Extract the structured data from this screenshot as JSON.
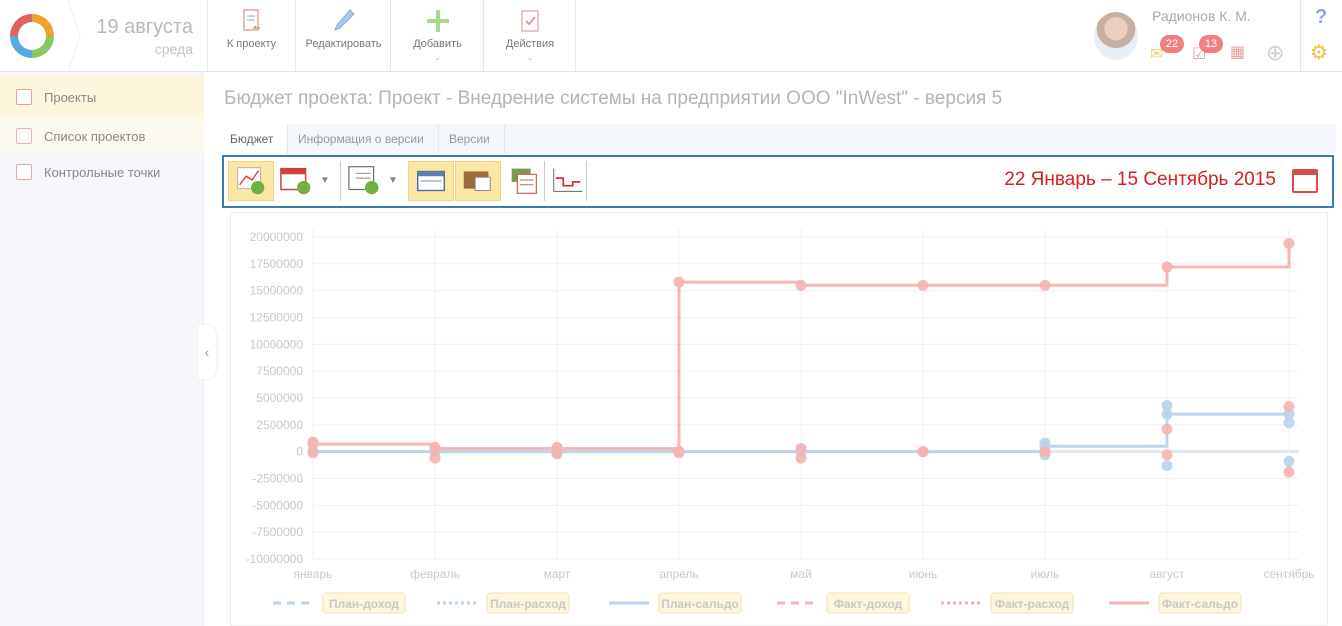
{
  "header": {
    "date_main": "19 августа",
    "date_sub": "среда",
    "buttons": [
      {
        "label": "К проекту",
        "icon": "document-back-icon"
      },
      {
        "label": "Редактировать",
        "icon": "pencil-icon"
      },
      {
        "label": "Добавить",
        "icon": "plus-icon"
      },
      {
        "label": "Действия",
        "icon": "checklist-icon"
      }
    ],
    "user_name": "Радионов К. М.",
    "badges": {
      "mail": "22",
      "tasks": "13"
    }
  },
  "sidebar": {
    "items": [
      {
        "label": "Проекты"
      },
      {
        "label": "Список проектов"
      },
      {
        "label": "Контрольные точки"
      }
    ]
  },
  "main": {
    "title": "Бюджет проекта: Проект - Внедрение системы на предприятии ООО \"InWest\" - версия 5",
    "tabs": [
      {
        "label": "Бюджет"
      },
      {
        "label": "Информация о версии"
      },
      {
        "label": "Версии"
      }
    ],
    "period": "22 Январь – 15 Сентябрь 2015"
  },
  "colors": {
    "plan": "#b8d3ec",
    "fact": "#f4b4b0",
    "period_red": "#d42020",
    "toolbar_border": "#3b7bb5"
  },
  "chart_data": {
    "type": "line",
    "categories": [
      "январь",
      "февраль",
      "март",
      "апрель",
      "май",
      "июнь",
      "июль",
      "август",
      "сентябрь"
    ],
    "ylim": [
      -10000000,
      20000000
    ],
    "yticks": [
      "20000000",
      "17500000",
      "15000000",
      "12500000",
      "10000000",
      "7500000",
      "5000000",
      "2500000",
      "0",
      "-2500000",
      "-5000000",
      "-7500000",
      "-10000000"
    ],
    "grid": true,
    "legend_position": "bottom",
    "series": [
      {
        "name": "План-доход",
        "style": "dashed",
        "color": "#b8d3ec",
        "values": [
          0,
          0,
          0,
          0,
          0,
          0,
          800000,
          4300000,
          2700000
        ]
      },
      {
        "name": "План-расход",
        "style": "dotted",
        "color": "#b8d3ec",
        "values": [
          0,
          0,
          0,
          0,
          0,
          0,
          -300000,
          -1300000,
          -900000
        ]
      },
      {
        "name": "План-сальдо",
        "style": "solid-step",
        "color": "#b8d3ec",
        "values": [
          0,
          0,
          0,
          0,
          0,
          0,
          500000,
          3500000,
          3500000
        ]
      },
      {
        "name": "Факт-доход",
        "style": "dashed",
        "color": "#f4b4b0",
        "values": [
          900000,
          400000,
          400000,
          0,
          300000,
          0,
          0,
          2100000,
          4200000
        ]
      },
      {
        "name": "Факт-расход",
        "style": "dotted",
        "color": "#f4b4b0",
        "values": [
          -100000,
          -600000,
          -200000,
          -100000,
          -600000,
          0,
          0,
          -300000,
          -1900000
        ]
      },
      {
        "name": "Факт-сальдо",
        "style": "solid-step",
        "color": "#f4b4b0",
        "values": [
          700000,
          300000,
          300000,
          15800000,
          15500000,
          15500000,
          15500000,
          17200000,
          19400000
        ]
      }
    ]
  }
}
